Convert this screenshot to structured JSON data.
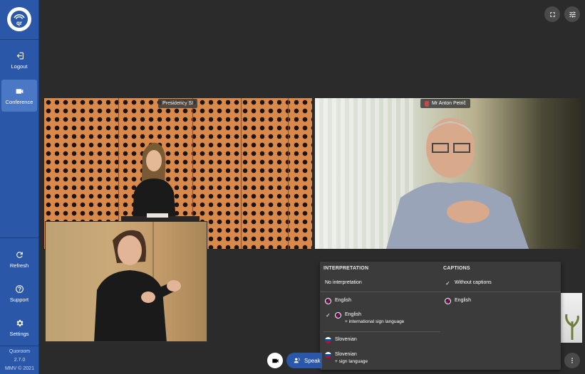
{
  "app": {
    "name": "Quoroom",
    "version": "2.7.0",
    "copyright": "MMV © 2021"
  },
  "sidebar": {
    "items": [
      {
        "id": "logout",
        "label": "Logout"
      },
      {
        "id": "conference",
        "label": "Conference"
      },
      {
        "id": "refresh",
        "label": "Refresh"
      },
      {
        "id": "support",
        "label": "Support"
      },
      {
        "id": "settings",
        "label": "Settings"
      }
    ]
  },
  "tiles": {
    "presidency": {
      "label": "Presidency SI"
    },
    "anton": {
      "label": "Mr Anton Petrič"
    }
  },
  "panel": {
    "interpretation": {
      "heading": "INTERPRETATION",
      "options": [
        {
          "label": "No interpretation",
          "sub": "",
          "checked": false,
          "flag": ""
        },
        {
          "label": "English",
          "sub": "",
          "checked": false,
          "flag": "uk"
        },
        {
          "label": "English",
          "sub": "+ international sign language",
          "checked": true,
          "flag": "uk"
        },
        {
          "label": "Slovenian",
          "sub": "",
          "checked": false,
          "flag": "si"
        },
        {
          "label": "Slovenian",
          "sub": "+ sign language",
          "checked": false,
          "flag": "si"
        }
      ]
    },
    "captions": {
      "heading": "CAPTIONS",
      "options": [
        {
          "label": "Without captions",
          "checked": true,
          "flag": ""
        },
        {
          "label": "English",
          "checked": false,
          "flag": "uk"
        }
      ]
    }
  },
  "controls": {
    "speak_label": "Speak"
  },
  "icons": {
    "logo": "quoroom-logo-icon",
    "logout": "logout-icon",
    "conference": "camera-icon",
    "refresh": "refresh-icon",
    "support": "help-icon",
    "settings": "gear-icon",
    "fullscreen": "fullscreen-icon",
    "tune": "sliders-icon",
    "more": "more-vertical-icon"
  },
  "colors": {
    "sidebar": "#2a57a8",
    "active": "#4b78c4",
    "panel": "#3b3b3b"
  }
}
